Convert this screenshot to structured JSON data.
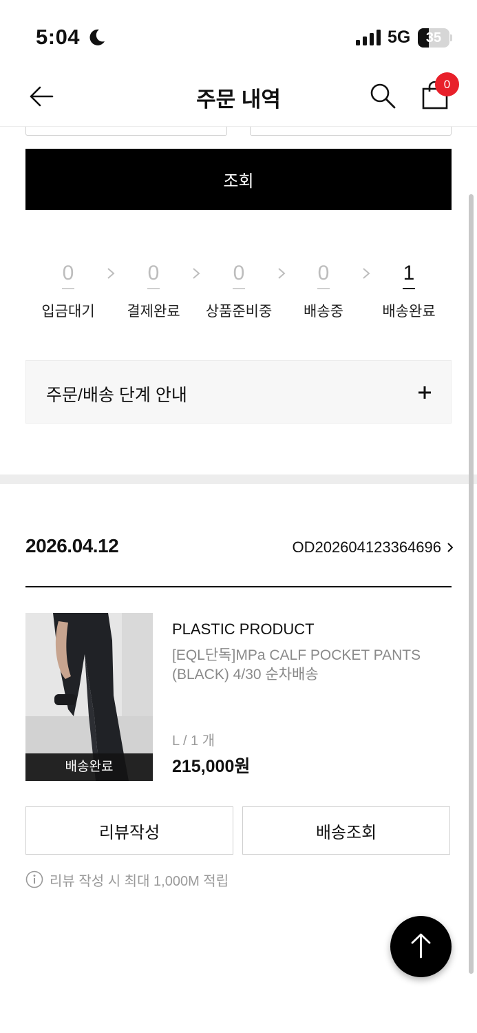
{
  "status_bar": {
    "time": "5:04",
    "network": "5G",
    "battery_level": "35",
    "battery_fraction": 0.35,
    "icons": [
      "moon-icon",
      "signal-icon",
      "battery-icon"
    ]
  },
  "header": {
    "title": "주문 내역",
    "cart_count": "0",
    "badge_color": "#e8202a",
    "icons": [
      "back-arrow-icon",
      "search-icon",
      "shopping-bag-icon"
    ]
  },
  "filter": {
    "search_label": "조회"
  },
  "steps": [
    {
      "count": "0",
      "label": "입금대기",
      "active": false
    },
    {
      "count": "0",
      "label": "결제완료",
      "active": false
    },
    {
      "count": "0",
      "label": "상품준비중",
      "active": false
    },
    {
      "count": "0",
      "label": "배송중",
      "active": false
    },
    {
      "count": "1",
      "label": "배송완료",
      "active": true
    }
  ],
  "guide": {
    "label": "주문/배송 단계 안내",
    "icon": "plus-icon"
  },
  "order": {
    "date": "2026.04.12",
    "number": "OD202604123364696",
    "product": {
      "image_status": "배송완료",
      "brand": "PLASTIC PRODUCT",
      "name": "[EQL단독]MPa CALF POCKET PANTS (BLACK) 4/30 순차배송",
      "option": "L / 1 개",
      "price": "215,000원"
    },
    "buttons": {
      "review": "리뷰작성",
      "tracking": "배송조회"
    },
    "reward_note": "리뷰 작성 시 최대 1,000M 적립"
  },
  "colors": {
    "primary": "#000000",
    "muted": "#9a9a9a",
    "panel": "#f7f7f7"
  }
}
